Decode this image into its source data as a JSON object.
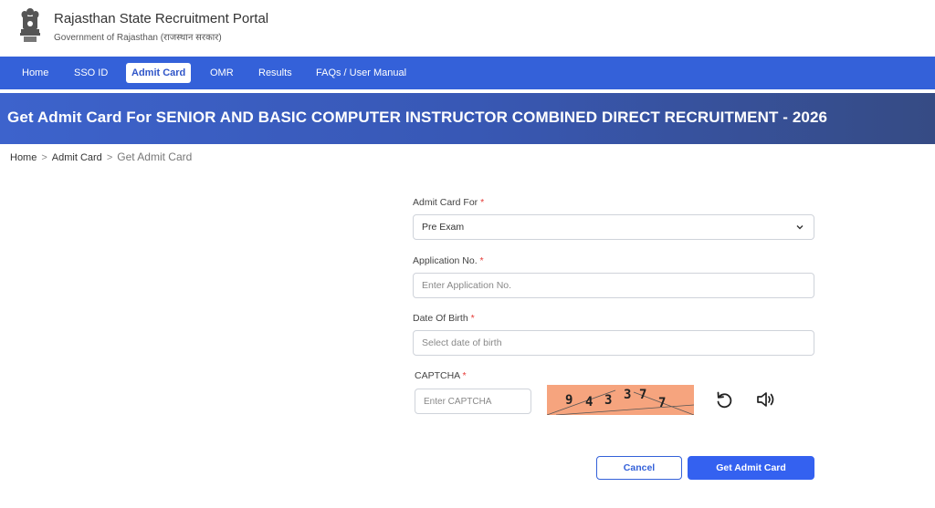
{
  "header": {
    "title": "Rajasthan State Recruitment Portal",
    "subtitle": "Government of Rajasthan (राजस्थान सरकार)",
    "emblem_icon": "state-emblem-icon"
  },
  "nav": {
    "items": [
      "Home",
      "SSO ID",
      "Admit Card",
      "OMR",
      "Results",
      "FAQs / User Manual"
    ],
    "active": "Admit Card"
  },
  "banner": {
    "title": "Get Admit Card For SENIOR AND BASIC COMPUTER INSTRUCTOR COMBINED DIRECT RECRUITMENT - 2026"
  },
  "breadcrumb": {
    "items": [
      "Home",
      "Admit Card",
      "Get Admit Card"
    ],
    "separator": ">"
  },
  "form": {
    "admit_card_for": {
      "label": "Admit Card For",
      "value": "Pre Exam"
    },
    "application_no": {
      "label": "Application No.",
      "placeholder": "Enter Application No."
    },
    "dob": {
      "label": "Date Of Birth",
      "placeholder": "Select date of birth"
    },
    "captcha": {
      "label": "CAPTCHA",
      "placeholder": "Enter CAPTCHA",
      "digits": [
        "9",
        "4",
        "3",
        "3",
        "7",
        "7"
      ]
    },
    "required_mark": "*",
    "cancel_label": "Cancel",
    "submit_label": "Get Admit Card"
  },
  "colors": {
    "primary": "#3461d9",
    "button_primary": "#3461f0",
    "captcha_bg": "#f6a47e",
    "required": "#e53935"
  }
}
